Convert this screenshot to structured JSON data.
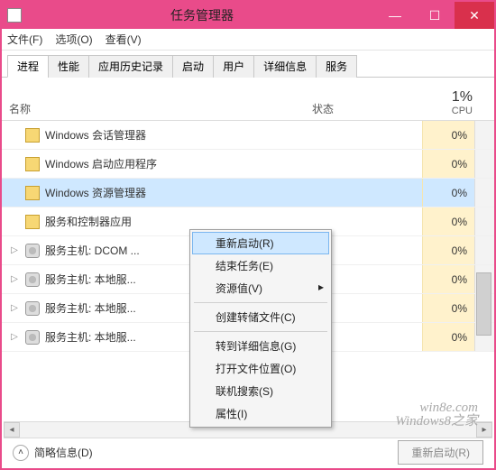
{
  "window": {
    "title": "任务管理器"
  },
  "menu": {
    "file": "文件(F)",
    "options": "选项(O)",
    "view": "查看(V)"
  },
  "tabs": [
    "进程",
    "性能",
    "应用历史记录",
    "启动",
    "用户",
    "详细信息",
    "服务"
  ],
  "active_tab": 0,
  "columns": {
    "name": "名称",
    "status": "状态",
    "cpu_pct": "1%",
    "cpu_label": "CPU"
  },
  "processes": [
    {
      "name": "Windows 会话管理器",
      "cpu": "0%",
      "expandable": false,
      "icon": "folder",
      "selected": false
    },
    {
      "name": "Windows 启动应用程序",
      "cpu": "0%",
      "expandable": false,
      "icon": "folder",
      "selected": false
    },
    {
      "name": "Windows 资源管理器",
      "cpu": "0%",
      "expandable": false,
      "icon": "folder",
      "selected": true
    },
    {
      "name": "服务和控制器应用",
      "cpu": "0%",
      "expandable": false,
      "icon": "folder",
      "selected": false
    },
    {
      "name": "服务主机: DCOM ...",
      "cpu": "0%",
      "expandable": true,
      "icon": "gear",
      "selected": false
    },
    {
      "name": "服务主机: 本地服...",
      "cpu": "0%",
      "expandable": true,
      "icon": "gear",
      "selected": false
    },
    {
      "name": "服务主机: 本地服...",
      "cpu": "0%",
      "expandable": true,
      "icon": "gear",
      "selected": false
    },
    {
      "name": "服务主机: 本地服...",
      "cpu": "0%",
      "expandable": true,
      "icon": "gear",
      "selected": false
    }
  ],
  "context_menu": {
    "restart": "重新启动(R)",
    "end_task": "结束任务(E)",
    "resource_values": "资源值(V)",
    "create_dump": "创建转储文件(C)",
    "go_details": "转到详细信息(G)",
    "open_location": "打开文件位置(O)",
    "search_online": "联机搜索(S)",
    "properties": "属性(I)"
  },
  "footer": {
    "fewer_details": "简略信息(D)",
    "action_button": "重新启动(R)"
  },
  "watermark": {
    "line1": "win8e.com",
    "line2": "Windows8之家"
  }
}
